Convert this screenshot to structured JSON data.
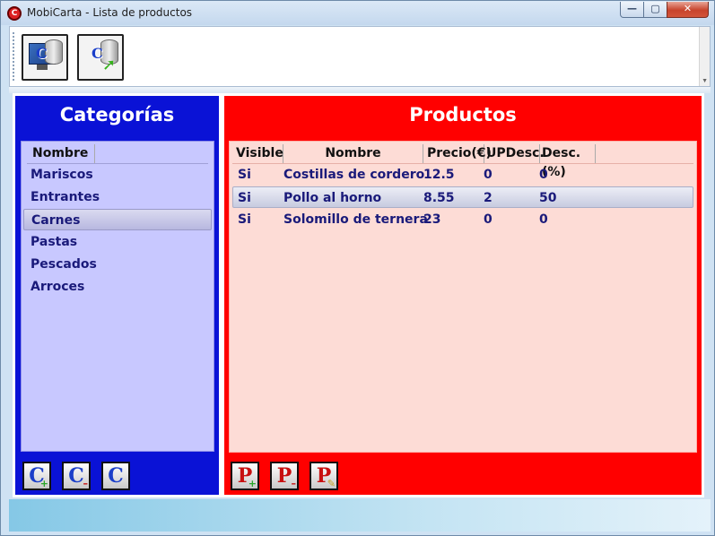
{
  "window": {
    "title": "MobiCarta - Lista de productos",
    "controls": {
      "minimize": "—",
      "maximize": "▢",
      "close": "✕"
    }
  },
  "toolbar": {
    "buttons": [
      {
        "icon": "monitor-database-sync-icon",
        "letter": "C"
      },
      {
        "icon": "database-upload-icon",
        "letter": "C"
      }
    ]
  },
  "categories": {
    "title": "Categorías",
    "column": "Nombre",
    "items": [
      "Mariscos",
      "Entrantes",
      "Carnes",
      "Pastas",
      "Pescados",
      "Arroces"
    ],
    "selected": "Carnes",
    "buttons": [
      {
        "icon": "add-category-icon",
        "letter": "C",
        "badge": "+"
      },
      {
        "icon": "remove-category-icon",
        "letter": "C",
        "badge": "–"
      },
      {
        "icon": "edit-category-icon",
        "letter": "C",
        "badge": ""
      }
    ]
  },
  "products": {
    "title": "Productos",
    "columns": [
      "Visible",
      "Nombre",
      "Precio(€)",
      "UPDesc.",
      "Desc.(%)"
    ],
    "rows": [
      {
        "visible": "Si",
        "name": "Costillas de cordero",
        "price": "12.5",
        "updesc": "0",
        "desc": "0"
      },
      {
        "visible": "Si",
        "name": "Pollo al horno",
        "price": "8.55",
        "updesc": "2",
        "desc": "50"
      },
      {
        "visible": "Si",
        "name": "Solomillo de ternera",
        "price": "23",
        "updesc": "0",
        "desc": "0"
      }
    ],
    "selected_row": 1,
    "buttons": [
      {
        "icon": "add-product-icon",
        "letter": "P",
        "badge": "+"
      },
      {
        "icon": "remove-product-icon",
        "letter": "P",
        "badge": "–"
      },
      {
        "icon": "edit-product-icon",
        "letter": "P",
        "badge": "✎"
      }
    ]
  },
  "colors": {
    "categories_panel": "#0a12d6",
    "products_panel": "#ff0000",
    "category_list_bg": "#c8c8ff",
    "product_list_bg": "#fddcd6"
  }
}
